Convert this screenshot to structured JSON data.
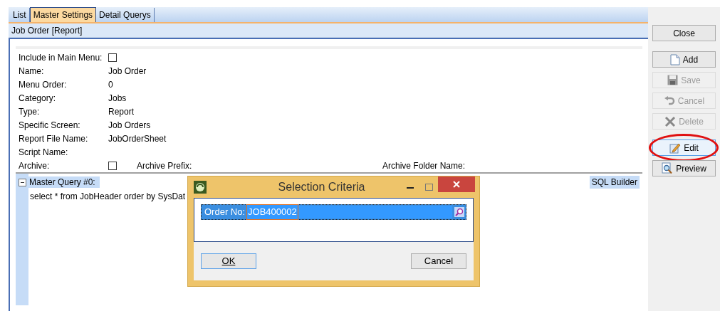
{
  "tabs": [
    {
      "label": "List",
      "selected": false
    },
    {
      "label": "Master Settings",
      "selected": true
    },
    {
      "label": "Detail Querys",
      "selected": false
    }
  ],
  "section_title": "Job Order [Report]",
  "fields": [
    {
      "label": "Include in Main Menu:",
      "kind": "checkbox",
      "checked": false
    },
    {
      "label": "Name:",
      "kind": "text",
      "value": "Job Order"
    },
    {
      "label": "Menu Order:",
      "kind": "text",
      "value": "0"
    },
    {
      "label": "Category:",
      "kind": "text",
      "value": "Jobs"
    },
    {
      "label": "Type:",
      "kind": "text",
      "value": "Report"
    },
    {
      "label": "Specific Screen:",
      "kind": "text",
      "value": "Job Orders"
    },
    {
      "label": "Report File Name:",
      "kind": "text",
      "value": "JobOrderSheet"
    },
    {
      "label": "Script Name:",
      "kind": "text"
    }
  ],
  "archive": {
    "label": "Archive:",
    "checked": false,
    "prefix_label": "Archive Prefix:",
    "folder_label": "Archive Folder Name:"
  },
  "query": {
    "title": "Master Query #0:",
    "expanded": true,
    "sql": "select * from JobHeader order by SysDat",
    "builder": "SQL Builder"
  },
  "dialog": {
    "title": "Selection Criteria",
    "field_label": "Order No:",
    "field_value": "JOB400002",
    "ok": "OK",
    "cancel": "Cancel"
  },
  "buttons": [
    {
      "label": "Close",
      "kind": "plain",
      "disabled": false,
      "highlighted": false
    },
    {
      "label": "Add",
      "kind": "page",
      "disabled": false,
      "highlighted": false
    },
    {
      "label": "Save",
      "kind": "disk",
      "disabled": true,
      "highlighted": false
    },
    {
      "label": "Cancel",
      "kind": "undo",
      "disabled": true,
      "highlighted": false
    },
    {
      "label": "Delete",
      "kind": "x",
      "disabled": true,
      "highlighted": false
    },
    {
      "label": "Edit",
      "kind": "pencil",
      "disabled": false,
      "highlighted": true
    },
    {
      "label": "Preview",
      "kind": "magnifier",
      "disabled": false,
      "highlighted": false
    }
  ]
}
